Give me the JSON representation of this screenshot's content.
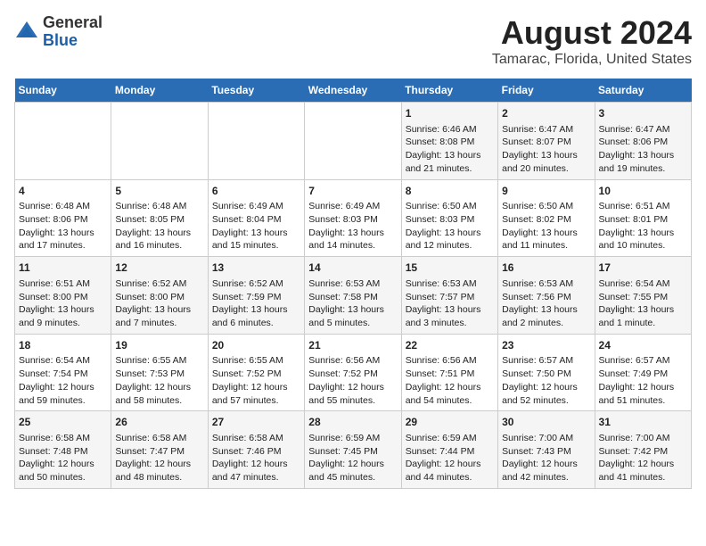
{
  "logo": {
    "general": "General",
    "blue": "Blue"
  },
  "title": "August 2024",
  "subtitle": "Tamarac, Florida, United States",
  "days_of_week": [
    "Sunday",
    "Monday",
    "Tuesday",
    "Wednesday",
    "Thursday",
    "Friday",
    "Saturday"
  ],
  "weeks": [
    [
      {
        "day": "",
        "content": ""
      },
      {
        "day": "",
        "content": ""
      },
      {
        "day": "",
        "content": ""
      },
      {
        "day": "",
        "content": ""
      },
      {
        "day": "1",
        "content": "Sunrise: 6:46 AM\nSunset: 8:08 PM\nDaylight: 13 hours\nand 21 minutes."
      },
      {
        "day": "2",
        "content": "Sunrise: 6:47 AM\nSunset: 8:07 PM\nDaylight: 13 hours\nand 20 minutes."
      },
      {
        "day": "3",
        "content": "Sunrise: 6:47 AM\nSunset: 8:06 PM\nDaylight: 13 hours\nand 19 minutes."
      }
    ],
    [
      {
        "day": "4",
        "content": "Sunrise: 6:48 AM\nSunset: 8:06 PM\nDaylight: 13 hours\nand 17 minutes."
      },
      {
        "day": "5",
        "content": "Sunrise: 6:48 AM\nSunset: 8:05 PM\nDaylight: 13 hours\nand 16 minutes."
      },
      {
        "day": "6",
        "content": "Sunrise: 6:49 AM\nSunset: 8:04 PM\nDaylight: 13 hours\nand 15 minutes."
      },
      {
        "day": "7",
        "content": "Sunrise: 6:49 AM\nSunset: 8:03 PM\nDaylight: 13 hours\nand 14 minutes."
      },
      {
        "day": "8",
        "content": "Sunrise: 6:50 AM\nSunset: 8:03 PM\nDaylight: 13 hours\nand 12 minutes."
      },
      {
        "day": "9",
        "content": "Sunrise: 6:50 AM\nSunset: 8:02 PM\nDaylight: 13 hours\nand 11 minutes."
      },
      {
        "day": "10",
        "content": "Sunrise: 6:51 AM\nSunset: 8:01 PM\nDaylight: 13 hours\nand 10 minutes."
      }
    ],
    [
      {
        "day": "11",
        "content": "Sunrise: 6:51 AM\nSunset: 8:00 PM\nDaylight: 13 hours\nand 9 minutes."
      },
      {
        "day": "12",
        "content": "Sunrise: 6:52 AM\nSunset: 8:00 PM\nDaylight: 13 hours\nand 7 minutes."
      },
      {
        "day": "13",
        "content": "Sunrise: 6:52 AM\nSunset: 7:59 PM\nDaylight: 13 hours\nand 6 minutes."
      },
      {
        "day": "14",
        "content": "Sunrise: 6:53 AM\nSunset: 7:58 PM\nDaylight: 13 hours\nand 5 minutes."
      },
      {
        "day": "15",
        "content": "Sunrise: 6:53 AM\nSunset: 7:57 PM\nDaylight: 13 hours\nand 3 minutes."
      },
      {
        "day": "16",
        "content": "Sunrise: 6:53 AM\nSunset: 7:56 PM\nDaylight: 13 hours\nand 2 minutes."
      },
      {
        "day": "17",
        "content": "Sunrise: 6:54 AM\nSunset: 7:55 PM\nDaylight: 13 hours\nand 1 minute."
      }
    ],
    [
      {
        "day": "18",
        "content": "Sunrise: 6:54 AM\nSunset: 7:54 PM\nDaylight: 12 hours\nand 59 minutes."
      },
      {
        "day": "19",
        "content": "Sunrise: 6:55 AM\nSunset: 7:53 PM\nDaylight: 12 hours\nand 58 minutes."
      },
      {
        "day": "20",
        "content": "Sunrise: 6:55 AM\nSunset: 7:52 PM\nDaylight: 12 hours\nand 57 minutes."
      },
      {
        "day": "21",
        "content": "Sunrise: 6:56 AM\nSunset: 7:52 PM\nDaylight: 12 hours\nand 55 minutes."
      },
      {
        "day": "22",
        "content": "Sunrise: 6:56 AM\nSunset: 7:51 PM\nDaylight: 12 hours\nand 54 minutes."
      },
      {
        "day": "23",
        "content": "Sunrise: 6:57 AM\nSunset: 7:50 PM\nDaylight: 12 hours\nand 52 minutes."
      },
      {
        "day": "24",
        "content": "Sunrise: 6:57 AM\nSunset: 7:49 PM\nDaylight: 12 hours\nand 51 minutes."
      }
    ],
    [
      {
        "day": "25",
        "content": "Sunrise: 6:58 AM\nSunset: 7:48 PM\nDaylight: 12 hours\nand 50 minutes."
      },
      {
        "day": "26",
        "content": "Sunrise: 6:58 AM\nSunset: 7:47 PM\nDaylight: 12 hours\nand 48 minutes."
      },
      {
        "day": "27",
        "content": "Sunrise: 6:58 AM\nSunset: 7:46 PM\nDaylight: 12 hours\nand 47 minutes."
      },
      {
        "day": "28",
        "content": "Sunrise: 6:59 AM\nSunset: 7:45 PM\nDaylight: 12 hours\nand 45 minutes."
      },
      {
        "day": "29",
        "content": "Sunrise: 6:59 AM\nSunset: 7:44 PM\nDaylight: 12 hours\nand 44 minutes."
      },
      {
        "day": "30",
        "content": "Sunrise: 7:00 AM\nSunset: 7:43 PM\nDaylight: 12 hours\nand 42 minutes."
      },
      {
        "day": "31",
        "content": "Sunrise: 7:00 AM\nSunset: 7:42 PM\nDaylight: 12 hours\nand 41 minutes."
      }
    ]
  ]
}
